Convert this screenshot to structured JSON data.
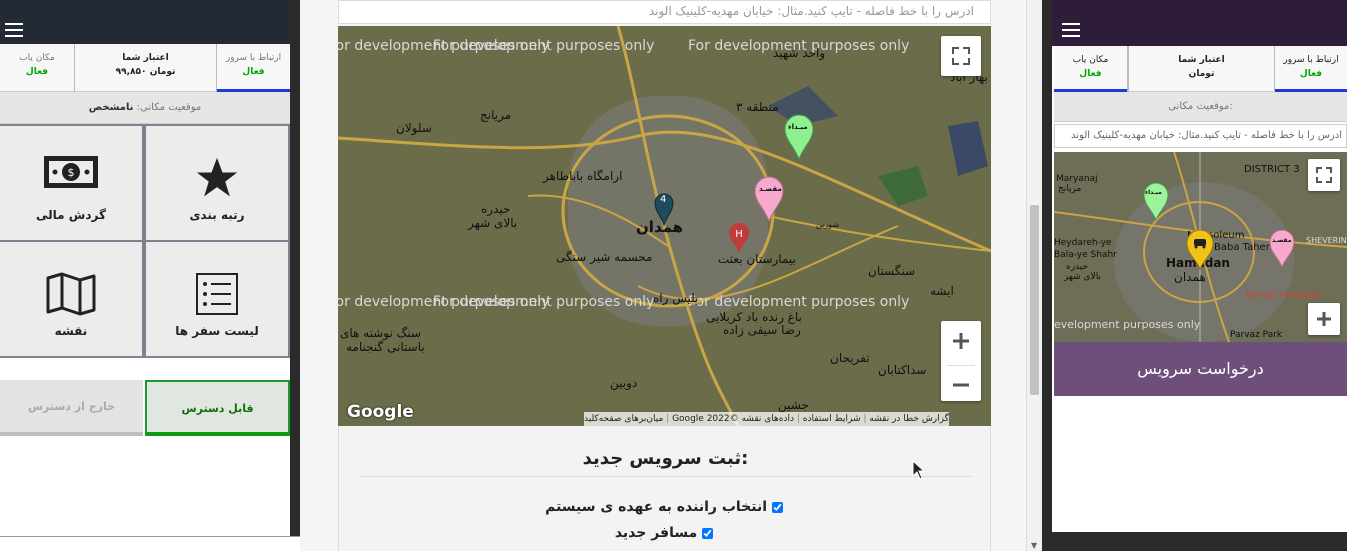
{
  "left_app": {
    "tabs": [
      {
        "title": "ارتباط با سرور",
        "status": "فعال"
      },
      {
        "title": "اعتبار شما",
        "value": "۹۹,۸۵۰ تومان"
      },
      {
        "title": "مکان یاب",
        "status": "فعال"
      }
    ],
    "location_label": "موقعیت مکانی:",
    "location_value": "نامشخص",
    "menu": [
      {
        "label": "رتبه بندی",
        "icon": "star-icon"
      },
      {
        "label": "گردش مالی",
        "icon": "money-icon"
      },
      {
        "label": "لیست سفر ها",
        "icon": "list-icon"
      },
      {
        "label": "نقشه",
        "icon": "map-icon"
      }
    ],
    "available_label": "قابل دسترس",
    "unavailable_label": "خارج از دسترس"
  },
  "web_panel": {
    "address_placeholder": "ادرس را با خط فاصله - تایپ کنید.مثال: خیابان مهدیه-کلینیک الوند",
    "map": {
      "dev_watermark": "For development purposes only",
      "labels": [
        "همدان",
        "مریانج",
        "سلولان",
        "ارامگاه باباطاهر",
        "حیدره",
        "بالای شهر",
        "محسمه شیر سنگی",
        "بیمارستان بعثت",
        "سنگستان",
        "باغ رنده باد کربلایی",
        "رضا سیفی زاده",
        "تفریجان",
        "سداکتابان",
        "دوبین",
        "جشین",
        "منطقه ۳",
        "واحد شهید",
        "بهار آباد",
        "پلیس راه",
        "شورین",
        "ایشه",
        "سنگ نوشته های",
        "باستانی گنجنامه"
      ],
      "marker_origin": "مبـداء",
      "marker_dest": "مقصـد",
      "marker_count": "4",
      "attribution": [
        "گزارش خطا در نقشه",
        "شرایط استفاده",
        "داده‌های نقشه ©2022 Google",
        "میان‌برهای صفحه‌کلید"
      ],
      "logo": "Google"
    },
    "form_title": "ثبت سرویس جدید:",
    "checkboxes": [
      {
        "label": "انتخاب راننده به عهده ی سیستم",
        "checked": true
      },
      {
        "label": "مسافر جدید",
        "checked": true
      }
    ]
  },
  "right_app": {
    "tabs": [
      {
        "title": "ارتباط با سرور",
        "status": "فعال"
      },
      {
        "title": "اعتبار شما",
        "value": "تومان"
      },
      {
        "title": "مکان یاب",
        "status": "فعال"
      }
    ],
    "location_label": "موقعیت مکانی:",
    "address_placeholder": "ادرس را با خط فاصله - تایپ کنید.مثال: خیابان مهدیه-کلینیک الوند",
    "map_labels": [
      "DISTRICT 3",
      "Maryanaj",
      "مریانج",
      "Mausoleum",
      "Baba Taher",
      "Heydareh-ye",
      "Bala-ye Shahr",
      "حیدره",
      "بالای شهر",
      "Hamadan",
      "همدان",
      "Be'sat Hospital",
      "Parvaz Park",
      "SHEVERIN",
      "evelopment purposes only"
    ],
    "marker_origin": "مبـداء",
    "marker_dest": "مقصـد",
    "request_button": "درخواست سرویس"
  }
}
